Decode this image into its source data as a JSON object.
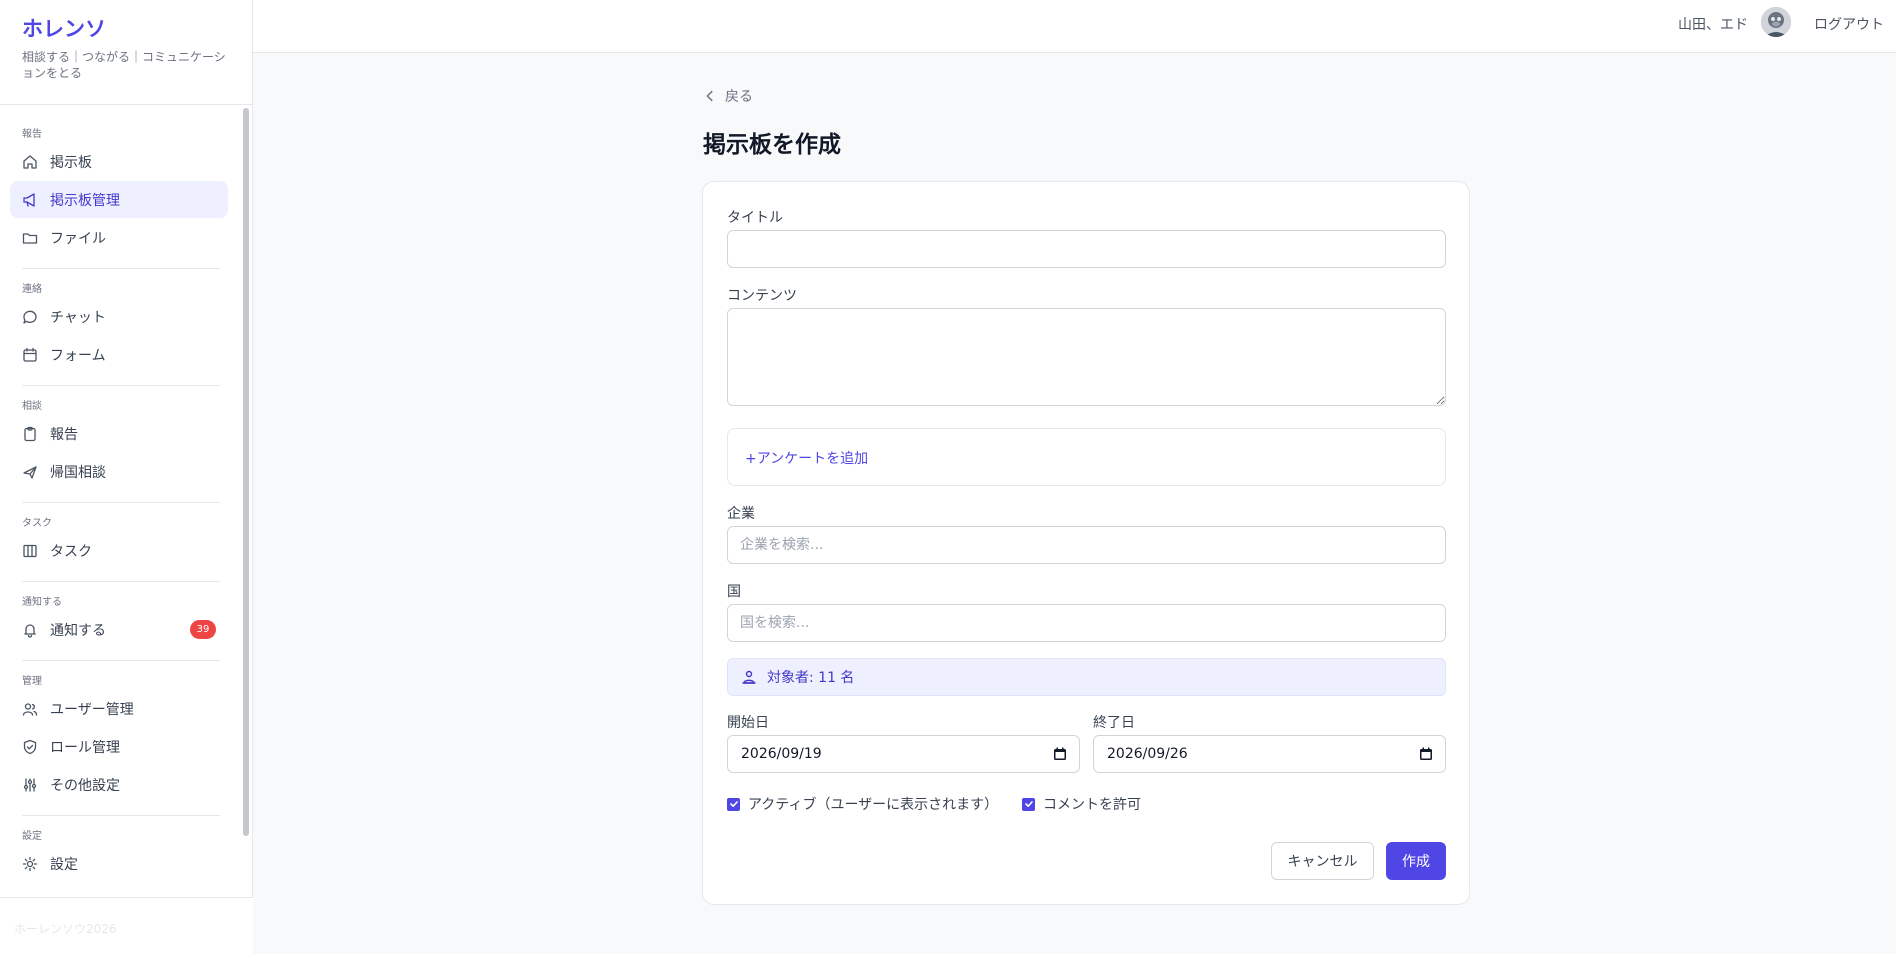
{
  "app": {
    "title": "ホレンソ",
    "tagline": "相談する｜つながる｜コミュニケーションをとる",
    "footer": "ホーレンソウ2026"
  },
  "sidebar": {
    "sections": [
      {
        "label": "報告",
        "items": [
          {
            "label": "掲示板",
            "icon": "home-icon"
          },
          {
            "label": "掲示板管理",
            "icon": "megaphone-icon",
            "active": true
          },
          {
            "label": "ファイル",
            "icon": "folder-icon"
          }
        ]
      },
      {
        "label": "連絡",
        "items": [
          {
            "label": "チャット",
            "icon": "chat-bubble-icon"
          },
          {
            "label": "フォーム",
            "icon": "calendar-icon"
          }
        ]
      },
      {
        "label": "相談",
        "items": [
          {
            "label": "報告",
            "icon": "clipboard-icon"
          },
          {
            "label": "帰国相談",
            "icon": "airplane-icon"
          }
        ]
      },
      {
        "label": "タスク",
        "items": [
          {
            "label": "タスク",
            "icon": "kanban-icon"
          }
        ]
      },
      {
        "label": "通知する",
        "items": [
          {
            "label": "通知する",
            "icon": "bell-icon",
            "badge": "39"
          }
        ]
      },
      {
        "label": "管理",
        "items": [
          {
            "label": "ユーザー管理",
            "icon": "users-icon"
          },
          {
            "label": "ロール管理",
            "icon": "shield-check-icon"
          },
          {
            "label": "その他設定",
            "icon": "sliders-icon"
          }
        ]
      },
      {
        "label": "設定",
        "items": [
          {
            "label": "設定",
            "icon": "gear-icon"
          }
        ]
      }
    ]
  },
  "topbar": {
    "user_name": "山田、エド",
    "logout": "ログアウト"
  },
  "page": {
    "back": "戻る",
    "title": "掲示板を作成"
  },
  "form": {
    "title_label": "タイトル",
    "title_value": "",
    "content_label": "コンテンツ",
    "add_survey": "+アンケートを追加",
    "company_label": "企業",
    "company_placeholder": "企業を検索...",
    "country_label": "国",
    "country_placeholder": "国を検索...",
    "target_text": "対象者: 11 名",
    "start_label": "開始日",
    "start_value": "2026/09/19",
    "end_label": "終了日",
    "end_value": "2026/09/26",
    "active_label": "アクティブ（ユーザーに表示されます）",
    "active_checked": true,
    "allow_comments_label": "コメントを許可",
    "allow_comments_checked": true,
    "cancel": "キャンセル",
    "create": "作成"
  },
  "colors": {
    "accent": "#4f46e5",
    "badge": "#ef4444",
    "active_bg": "#eef0ff"
  }
}
